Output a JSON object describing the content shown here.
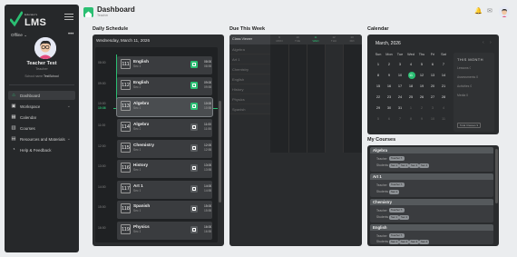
{
  "sidebar": {
    "logo_small": "Educator's",
    "logo_text": "LMS",
    "status": "Offline",
    "more_glyph": "•••",
    "profile": {
      "name": "Teacher Test",
      "role": "Teacher",
      "school_prefix": "School name",
      "school": "TestSchool"
    },
    "nav": [
      {
        "label": "Dashboard",
        "icon": "home-icon"
      },
      {
        "label": "Workspace",
        "icon": "workspace-icon"
      },
      {
        "label": "Calendar",
        "icon": "calendar-icon"
      },
      {
        "label": "Courses",
        "icon": "courses-icon"
      },
      {
        "label": "Resources and Materials",
        "icon": "resources-icon"
      },
      {
        "label": "Help & Feedback",
        "icon": "help-icon"
      }
    ]
  },
  "header": {
    "title": "Dashboard",
    "subtitle": "Teacher"
  },
  "schedule": {
    "title": "Daily Schedule",
    "date": "Wednesday, March 11, 2026",
    "times": [
      "08:00",
      "09:00",
      "10:00",
      "11:00",
      "12:00",
      "13:00",
      "14:00",
      "15:00",
      "16:00"
    ],
    "now_label": "10:36",
    "classes": [
      {
        "period": "111",
        "name": "English",
        "sec": "Sec 1",
        "start": "08:00",
        "end": "08:55"
      },
      {
        "period": "112",
        "name": "English",
        "sec": "Sec 2",
        "start": "09:00",
        "end": "09:55"
      },
      {
        "period": "113",
        "name": "Algebra",
        "sec": "Sec 1",
        "start": "10:00",
        "end": "10:55"
      },
      {
        "period": "114",
        "name": "Algebra",
        "sec": "Sec 2",
        "start": "11:00",
        "end": "11:55"
      },
      {
        "period": "115",
        "name": "Chemistry",
        "sec": "Sec 1",
        "start": "12:00",
        "end": "12:55"
      },
      {
        "period": "116",
        "name": "History",
        "sec": "Sec 1",
        "start": "13:00",
        "end": "13:55"
      },
      {
        "period": "117",
        "name": "Art 1",
        "sec": "Sec 1",
        "start": "14:00",
        "end": "14:55"
      },
      {
        "period": "118",
        "name": "Spanish",
        "sec": "Sec 1",
        "start": "15:00",
        "end": "15:55"
      },
      {
        "period": "119",
        "name": "Physics",
        "sec": "Sec 1",
        "start": "16:00",
        "end": "16:55"
      }
    ]
  },
  "due": {
    "title": "Due This Week",
    "viewer_label": "Class Viewer",
    "days": [
      {
        "n": "9",
        "d": "MON"
      },
      {
        "n": "10",
        "d": "TUE"
      },
      {
        "n": "11",
        "d": "WED"
      },
      {
        "n": "12",
        "d": "THU"
      },
      {
        "n": "13",
        "d": "FRI"
      }
    ],
    "classes": [
      "Algebra",
      "Art 1",
      "Chemistry",
      "English",
      "History",
      "Physics",
      "Spanish"
    ]
  },
  "calendar": {
    "title": "Calendar",
    "month": "March, 2026",
    "weekdays": [
      "Sun",
      "Mon",
      "Tue",
      "Wed",
      "Thu",
      "Fri",
      "Sat"
    ],
    "weeks": [
      [
        "1",
        "2",
        "3",
        "4",
        "5",
        "6",
        "7"
      ],
      [
        "8",
        "9",
        "10",
        "11",
        "12",
        "13",
        "14"
      ],
      [
        "15",
        "16",
        "17",
        "18",
        "19",
        "20",
        "21"
      ],
      [
        "22",
        "23",
        "24",
        "25",
        "26",
        "27",
        "28"
      ],
      [
        "29",
        "30",
        "31",
        "1",
        "2",
        "3",
        "4"
      ],
      [
        "5",
        "6",
        "7",
        "8",
        "9",
        "10",
        "11"
      ]
    ],
    "selected": "11",
    "this_month": {
      "title": "THIS MONTH",
      "items": [
        "Lessons 0",
        "Assessments 0",
        "Activities 0",
        "Media 0"
      ],
      "button": "Total Classes 9"
    }
  },
  "courses": {
    "title": "My Courses",
    "teacher_label": "Teacher",
    "students_label": "Students",
    "list": [
      {
        "name": "Algebra",
        "teacher": "Teacher T.",
        "sections": [
          "Sec 1",
          "Sec 2",
          "Sec 3",
          "Sec 4"
        ]
      },
      {
        "name": "Art 1",
        "teacher": "Teacher T.",
        "sections": [
          "Sec 1"
        ]
      },
      {
        "name": "Chemistry",
        "teacher": "Teacher T.",
        "sections": [
          "Sec 1",
          "Sec 2"
        ]
      },
      {
        "name": "English",
        "teacher": "Teacher T.",
        "sections": [
          "Sec 1",
          "Sec 2",
          "Sec 3",
          "Sec 4"
        ]
      }
    ]
  },
  "colors": {
    "accent": "#2bbf73",
    "sidebar": "#26282a",
    "panel": "#2a2c2e"
  }
}
